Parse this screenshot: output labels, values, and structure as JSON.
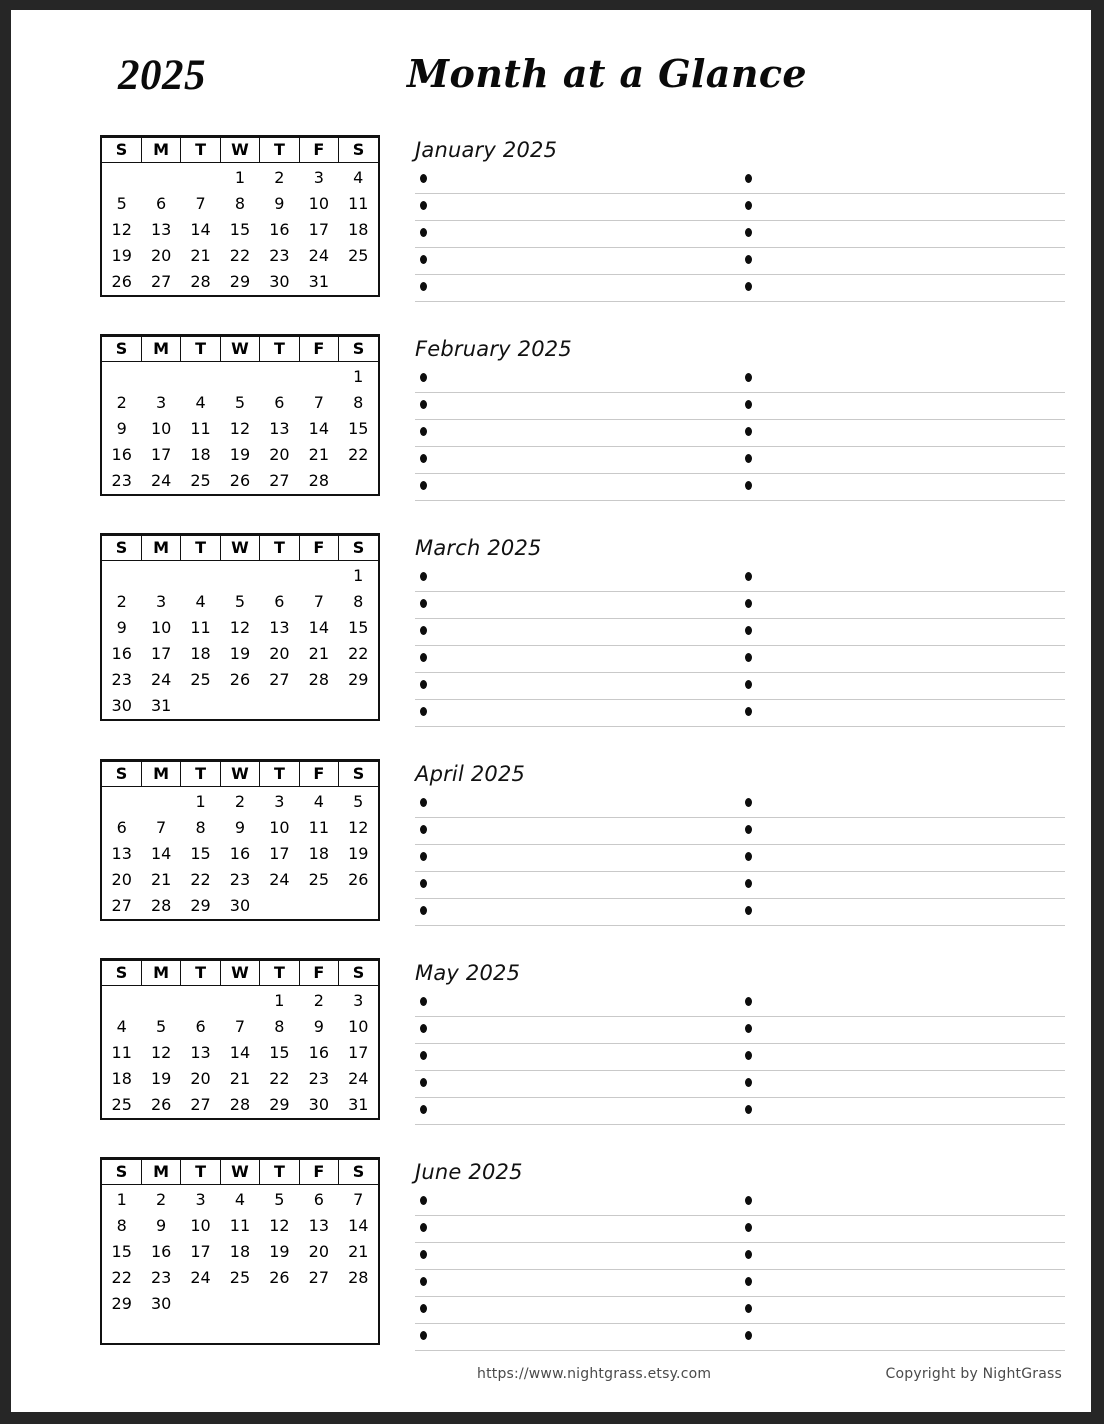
{
  "page": {
    "year_label": "2025",
    "title": "Month at a Glance",
    "border_color": "#262626",
    "paper_color": "#ffffff",
    "rule_color": "#c9c9c9",
    "ink_color": "#111111"
  },
  "weekday_headers": [
    "S",
    "M",
    "T",
    "W",
    "T",
    "F",
    "S"
  ],
  "footer": {
    "url": "https://www.nightgrass.etsy.com",
    "copyright": "Copyright by NightGrass"
  },
  "months": [
    {
      "name": "January 2025",
      "notes_title": "January 2025",
      "note_rows": 5,
      "weeks": [
        [
          "",
          "",
          "",
          "1",
          "2",
          "3",
          "4"
        ],
        [
          "5",
          "6",
          "7",
          "8",
          "9",
          "10",
          "11"
        ],
        [
          "12",
          "13",
          "14",
          "15",
          "16",
          "17",
          "18"
        ],
        [
          "19",
          "20",
          "21",
          "22",
          "23",
          "24",
          "25"
        ],
        [
          "26",
          "27",
          "28",
          "29",
          "30",
          "31",
          ""
        ]
      ]
    },
    {
      "name": "February 2025",
      "notes_title": "February 2025",
      "note_rows": 5,
      "weeks": [
        [
          "",
          "",
          "",
          "",
          "",
          "",
          "1"
        ],
        [
          "2",
          "3",
          "4",
          "5",
          "6",
          "7",
          "8"
        ],
        [
          "9",
          "10",
          "11",
          "12",
          "13",
          "14",
          "15"
        ],
        [
          "16",
          "17",
          "18",
          "19",
          "20",
          "21",
          "22"
        ],
        [
          "23",
          "24",
          "25",
          "26",
          "27",
          "28",
          ""
        ]
      ]
    },
    {
      "name": "March 2025",
      "notes_title": "March 2025",
      "note_rows": 6,
      "weeks": [
        [
          "",
          "",
          "",
          "",
          "",
          "",
          "1"
        ],
        [
          "2",
          "3",
          "4",
          "5",
          "6",
          "7",
          "8"
        ],
        [
          "9",
          "10",
          "11",
          "12",
          "13",
          "14",
          "15"
        ],
        [
          "16",
          "17",
          "18",
          "19",
          "20",
          "21",
          "22"
        ],
        [
          "23",
          "24",
          "25",
          "26",
          "27",
          "28",
          "29"
        ],
        [
          "30",
          "31",
          "",
          "",
          "",
          "",
          ""
        ]
      ]
    },
    {
      "name": "April 2025",
      "notes_title": "April 2025",
      "note_rows": 5,
      "weeks": [
        [
          "",
          "",
          "1",
          "2",
          "3",
          "4",
          "5"
        ],
        [
          "6",
          "7",
          "8",
          "9",
          "10",
          "11",
          "12"
        ],
        [
          "13",
          "14",
          "15",
          "16",
          "17",
          "18",
          "19"
        ],
        [
          "20",
          "21",
          "22",
          "23",
          "24",
          "25",
          "26"
        ],
        [
          "27",
          "28",
          "29",
          "30",
          "",
          "",
          ""
        ]
      ]
    },
    {
      "name": "May 2025",
      "notes_title": "May 2025",
      "note_rows": 5,
      "weeks": [
        [
          "",
          "",
          "",
          "",
          "1",
          "2",
          "3"
        ],
        [
          "4",
          "5",
          "6",
          "7",
          "8",
          "9",
          "10"
        ],
        [
          "11",
          "12",
          "13",
          "14",
          "15",
          "16",
          "17"
        ],
        [
          "18",
          "19",
          "20",
          "21",
          "22",
          "23",
          "24"
        ],
        [
          "25",
          "26",
          "27",
          "28",
          "29",
          "30",
          "31"
        ]
      ]
    },
    {
      "name": "June 2025",
      "notes_title": "June 2025",
      "note_rows": 6,
      "weeks": [
        [
          "1",
          "2",
          "3",
          "4",
          "5",
          "6",
          "7"
        ],
        [
          "8",
          "9",
          "10",
          "11",
          "12",
          "13",
          "14"
        ],
        [
          "15",
          "16",
          "17",
          "18",
          "19",
          "20",
          "21"
        ],
        [
          "22",
          "23",
          "24",
          "25",
          "26",
          "27",
          "28"
        ],
        [
          "29",
          "30",
          "",
          "",
          "",
          "",
          ""
        ],
        [
          "",
          "",
          "",
          "",
          "",
          "",
          ""
        ]
      ]
    }
  ]
}
